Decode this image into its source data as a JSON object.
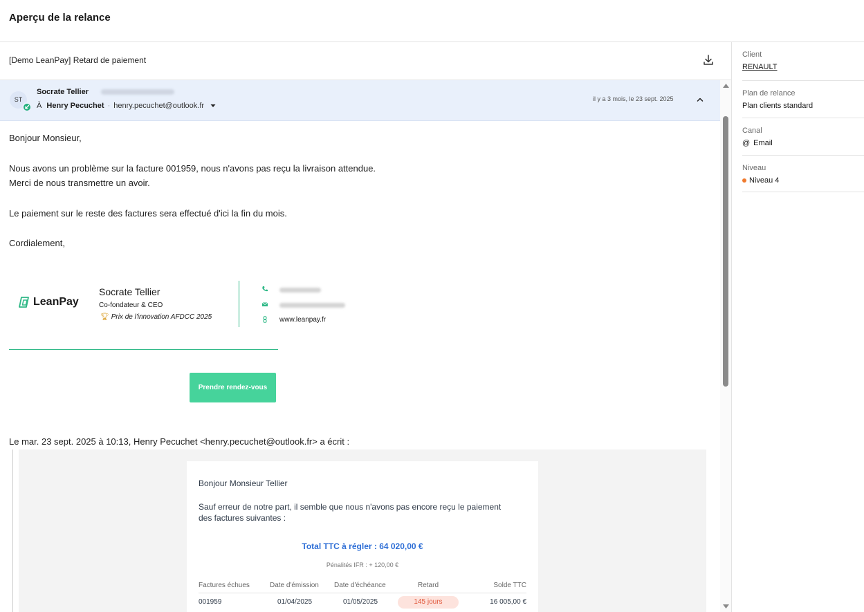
{
  "page": {
    "title": "Aperçu de la relance"
  },
  "email": {
    "subject": "[Demo LeanPay] Retard de paiement",
    "sender": {
      "initials": "ST",
      "name": "Socrate Tellier",
      "to_prefix": "À",
      "to_name": "Henry Pecuchet",
      "separator": "·",
      "to_email": "henry.pecuchet@outlook.fr"
    },
    "timestamp": "il y a 3 mois, le 23 sept. 2025",
    "body": [
      "Bonjour Monsieur,",
      "Nous avons un problème sur la facture 001959, nous n'avons pas reçu la livraison attendue.",
      "Merci de nous transmettre un avoir.",
      "Le paiement sur le reste des factures sera effectué d'ici la fin du mois.",
      "Cordialement,"
    ],
    "signature": {
      "logo_text": "LeanPay",
      "name": "Socrate Tellier",
      "role": "Co-fondateur & CEO",
      "award": "Prix de l'innovation AFDCC 2025",
      "website": "www.leanpay.fr",
      "button_label": "Prendre rendez-vous",
      "accent_color": "#2eb886"
    },
    "quote_header": "Le mar. 23 sept. 2025 à 10:13, Henry Pecuchet <henry.pecuchet@outlook.fr> a écrit :",
    "quoted": {
      "greeting": "Bonjour Monsieur Tellier",
      "paragraph_line1": "Sauf erreur de notre part, il semble que nous n'avons pas encore reçu le paiement",
      "paragraph_line2": "des factures suivantes :",
      "total": "Total TTC à régler : 64 020,00 €",
      "penalty": "Pénalités IFR : + 120,00 €",
      "columns": [
        "Factures échues",
        "Date d'émission",
        "Date d'échéance",
        "Retard",
        "Solde TTC"
      ],
      "rows": [
        {
          "invoice": "001959",
          "issued": "01/04/2025",
          "due": "01/05/2025",
          "delay": "145 jours",
          "balance": "16 005,00 €"
        }
      ]
    }
  },
  "sidebar": {
    "client": {
      "label": "Client",
      "value": "RENAULT"
    },
    "plan": {
      "label": "Plan de relance",
      "value": "Plan clients standard"
    },
    "canal": {
      "label": "Canal",
      "icon": "@",
      "value": "Email"
    },
    "niveau": {
      "label": "Niveau",
      "value": "Niveau 4",
      "color": "#f07a2e"
    }
  }
}
